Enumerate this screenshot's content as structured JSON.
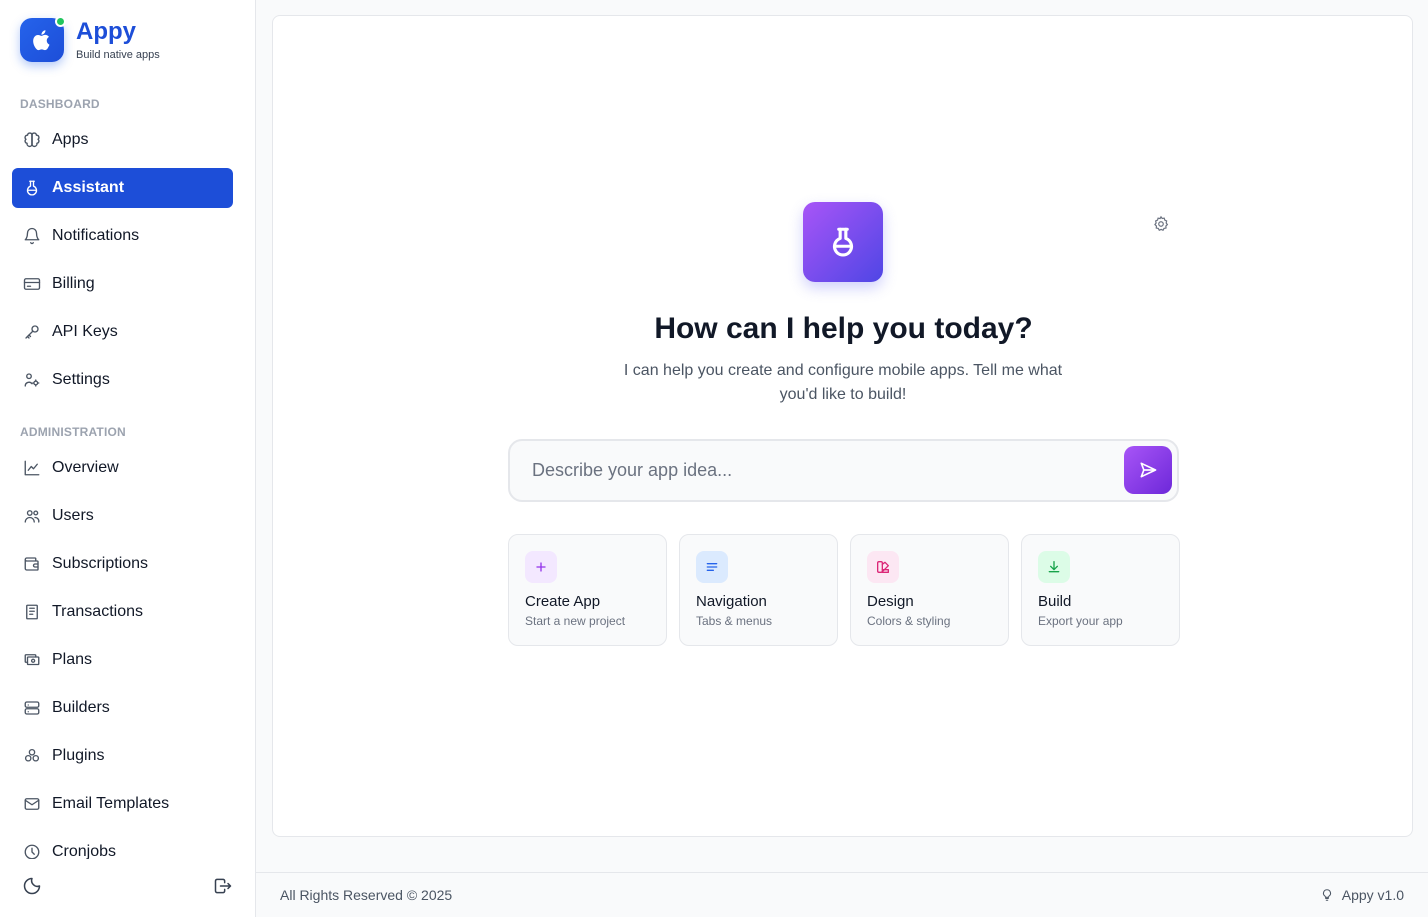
{
  "brand": {
    "name": "Appy",
    "tagline": "Build native apps"
  },
  "sidebar": {
    "sections": [
      {
        "label": "DASHBOARD"
      },
      {
        "label": "ADMINISTRATION"
      }
    ],
    "items": [
      {
        "label": "Apps",
        "icon": "brain-icon"
      },
      {
        "label": "Assistant",
        "icon": "flask-icon",
        "active": true
      },
      {
        "label": "Notifications",
        "icon": "bell-icon"
      },
      {
        "label": "Billing",
        "icon": "credit-card-icon"
      },
      {
        "label": "API Keys",
        "icon": "key-icon"
      },
      {
        "label": "Settings",
        "icon": "settings-icon"
      },
      {
        "label": "Overview",
        "icon": "chart-line-icon"
      },
      {
        "label": "Users",
        "icon": "users-icon"
      },
      {
        "label": "Subscriptions",
        "icon": "wallet-icon"
      },
      {
        "label": "Transactions",
        "icon": "receipt-icon"
      },
      {
        "label": "Plans",
        "icon": "cash-icon"
      },
      {
        "label": "Builders",
        "icon": "server-icon"
      },
      {
        "label": "Plugins",
        "icon": "puzzle-icon"
      },
      {
        "label": "Email Templates",
        "icon": "mail-icon"
      },
      {
        "label": "Cronjobs",
        "icon": "clock-icon"
      }
    ]
  },
  "assistant": {
    "title": "How can I help you today?",
    "subtitle": "I can help you create and configure mobile apps. Tell me what you'd like to build!",
    "input_placeholder": "Describe your app idea...",
    "input_value": "",
    "quick_actions": [
      {
        "title": "Create App",
        "subtitle": "Start a new project",
        "icon": "plus-icon",
        "color": "#9333ea",
        "bg": "#f3e8ff"
      },
      {
        "title": "Navigation",
        "subtitle": "Tabs & menus",
        "icon": "menu-icon",
        "color": "#2563eb",
        "bg": "#dbeafe"
      },
      {
        "title": "Design",
        "subtitle": "Colors & styling",
        "icon": "palette-icon",
        "color": "#db2777",
        "bg": "#fce7f3"
      },
      {
        "title": "Build",
        "subtitle": "Export your app",
        "icon": "download-icon",
        "color": "#16a34a",
        "bg": "#dcfce7"
      }
    ]
  },
  "footer": {
    "copyright": "All Rights Reserved © 2025",
    "version": "Appy v1.0"
  },
  "colors": {
    "primary": "#1d4ed8",
    "accent_start": "#a855f7",
    "accent_end": "#4f46e5"
  }
}
